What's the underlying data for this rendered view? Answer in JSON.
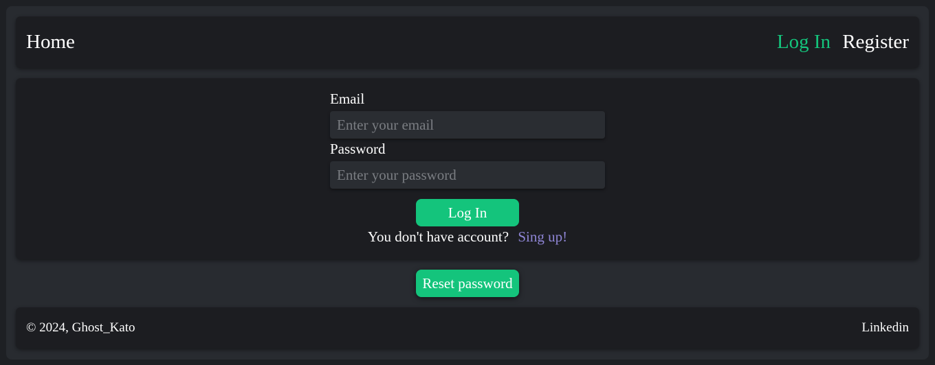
{
  "nav": {
    "home_label": "Home",
    "login_label": "Log In",
    "register_label": "Register"
  },
  "form": {
    "email_label": "Email",
    "email_placeholder": "Enter your email",
    "email_value": "",
    "password_label": "Password",
    "password_placeholder": "Enter your password",
    "password_value": "",
    "login_button_label": "Log In",
    "signup_prompt": "You don't have account?",
    "signup_link": "Sing up!"
  },
  "reset_button_label": "Reset password",
  "footer": {
    "copyright": "© 2024, Ghost_Kato",
    "linkedin_label": "Linkedin"
  },
  "colors": {
    "accent": "#14c47c",
    "link": "#8f86d6",
    "panel": "#1c1d21",
    "background": "#282b30"
  }
}
